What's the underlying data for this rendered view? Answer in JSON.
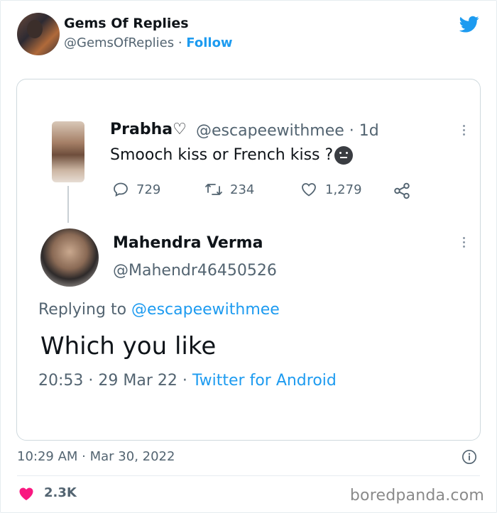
{
  "header": {
    "name": "Gems Of Replies",
    "handle": "@GemsOfReplies",
    "separator": "·",
    "follow_label": "Follow",
    "bird_icon": "twitter-bird-icon",
    "accent_color": "#1d9bf0"
  },
  "quoted": {
    "tweet1": {
      "name": "Prabha♡",
      "handle": "@escapeewithmee · 1d",
      "text": "Smooch kiss or French kiss ?",
      "replies": "729",
      "retweets": "234",
      "likes": "1,279"
    },
    "tweet2": {
      "name": "Mahendra Verma",
      "handle": "@Mahendr46450526",
      "replying_prefix": "Replying to ",
      "replying_to": "@escapeewithmee",
      "text": "Which you like",
      "meta_time": "20:53 · 29 Mar 22 · ",
      "meta_source": "Twitter for Android"
    }
  },
  "footer": {
    "timestamp": "10:29 AM · Mar 30, 2022",
    "likes_count": "2.3K",
    "watermark": "boredpanda.com"
  }
}
